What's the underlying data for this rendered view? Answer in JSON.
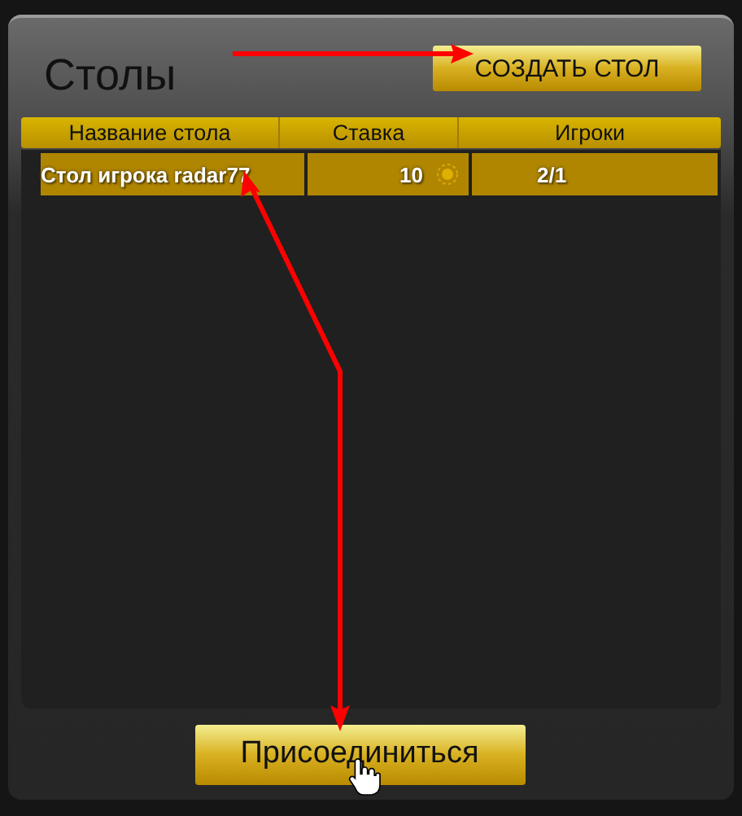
{
  "title": "Столы",
  "create_button": "СОЗДАТЬ СТОЛ",
  "table": {
    "columns": [
      "Название стола",
      "Ставка",
      "Игроки"
    ],
    "rows": [
      {
        "name": "Стол игрока radar77",
        "bet": "10",
        "players": "2/1",
        "selected": true
      }
    ]
  },
  "join_button": "Присоединиться"
}
